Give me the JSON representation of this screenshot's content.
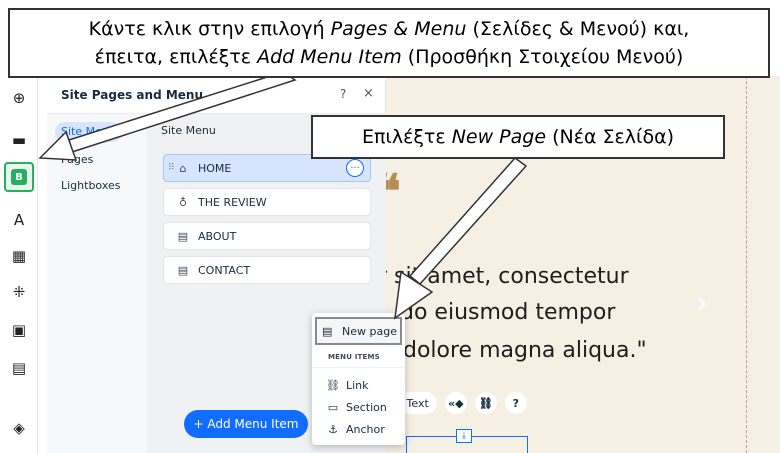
{
  "callouts": {
    "top": {
      "line1_pre": "Κάντε κλικ στην επιλογή ",
      "line1_em": "Pages & Menu",
      "line1_post": " (Σελίδες & Μενού) και,",
      "line2_pre": "έπειτα, επιλέξτε ",
      "line2_em": "Add Menu Item",
      "line2_post": " (Προσθήκη Στοιχείου Μενού)"
    },
    "right": {
      "pre": "Επιλέξτε ",
      "em": "New Page",
      "post": " (Νέα Σελίδα)"
    }
  },
  "toolbar": {
    "items": [
      {
        "icon": "plus-circle-icon",
        "glyph": "⊕"
      },
      {
        "icon": "sections-icon",
        "glyph": "▬"
      },
      {
        "icon": "pages-icon",
        "glyph": "B",
        "active": true
      },
      {
        "icon": "design-icon",
        "glyph": "A"
      },
      {
        "icon": "apps-icon",
        "glyph": "▦"
      },
      {
        "icon": "app-market-icon",
        "glyph": "⁜"
      },
      {
        "icon": "media-icon",
        "glyph": "▣"
      },
      {
        "icon": "cms-icon",
        "glyph": "▤"
      },
      {
        "icon": "layers-icon",
        "glyph": "◈"
      }
    ]
  },
  "panel": {
    "title": "Site Pages and Menu",
    "help": "?",
    "close": "×",
    "nav": [
      {
        "label": "Site Menu",
        "selected": true
      },
      {
        "label": "Pages"
      },
      {
        "label": "Lightboxes"
      }
    ],
    "section_label": "Site Menu",
    "menu_items": [
      {
        "label": "HOME",
        "icon": "home-icon",
        "glyph": "⌂",
        "selected": true
      },
      {
        "label": "THE REVIEW",
        "icon": "bulb-icon",
        "glyph": "♁"
      },
      {
        "label": "ABOUT",
        "icon": "page-icon",
        "glyph": "▤"
      },
      {
        "label": "CONTACT",
        "icon": "page-icon",
        "glyph": "▤"
      }
    ],
    "drag_handle": "⠿",
    "more_button": "···",
    "add_button": "+ Add Menu Item"
  },
  "canvas": {
    "quote": "❝",
    "lines": [
      "r sit amet, consectetur",
      "do eiusmod tempor",
      "dolore magna aliqua.\""
    ],
    "chevron": "›",
    "tools": {
      "text": "l Text",
      "icons": [
        "«◆",
        "⛓",
        "?"
      ]
    },
    "handle": "⤓"
  },
  "dropdown": {
    "new_page": "New page",
    "header": "MENU ITEMS",
    "items": [
      {
        "label": "Link",
        "icon": "link-icon",
        "glyph": "⛓"
      },
      {
        "label": "Section",
        "icon": "section-icon",
        "glyph": "▭"
      },
      {
        "label": "Anchor",
        "icon": "anchor-icon",
        "glyph": "⚓"
      }
    ]
  }
}
